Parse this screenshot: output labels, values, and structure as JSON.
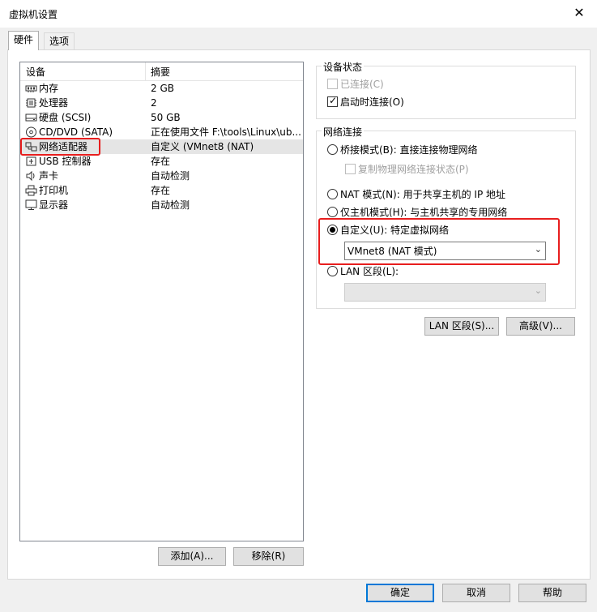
{
  "window": {
    "title": "虚拟机设置",
    "close_label": "✕"
  },
  "tabs": [
    {
      "label": "硬件"
    },
    {
      "label": "选项"
    }
  ],
  "device_list": {
    "headers": {
      "device": "设备",
      "summary": "摘要"
    },
    "rows": [
      {
        "device": "内存",
        "summary": "2 GB",
        "icon": "memory-icon"
      },
      {
        "device": "处理器",
        "summary": "2",
        "icon": "processor-icon"
      },
      {
        "device": "硬盘 (SCSI)",
        "summary": "50 GB",
        "icon": "hard-disk-icon"
      },
      {
        "device": "CD/DVD (SATA)",
        "summary": "正在使用文件 F:\\tools\\Linux\\ub...",
        "icon": "cd-dvd-icon"
      },
      {
        "device": "网络适配器",
        "summary": "自定义 (VMnet8 (NAT)",
        "icon": "network-adapter-icon"
      },
      {
        "device": "USB 控制器",
        "summary": "存在",
        "icon": "usb-icon"
      },
      {
        "device": "声卡",
        "summary": "自动检测",
        "icon": "sound-card-icon"
      },
      {
        "device": "打印机",
        "summary": "存在",
        "icon": "printer-icon"
      },
      {
        "device": "显示器",
        "summary": "自动检测",
        "icon": "display-icon"
      }
    ],
    "selected_index": 4
  },
  "device_status": {
    "title": "设备状态",
    "connected": {
      "label": "已连接(C)",
      "checked": false,
      "enabled": false
    },
    "connect_at_power_on": {
      "label": "启动时连接(O)",
      "checked": true,
      "enabled": true
    }
  },
  "network_connection": {
    "title": "网络连接",
    "bridged": {
      "label": "桥接模式(B): 直接连接物理网络",
      "selected": false
    },
    "replicate_state": {
      "label": "复制物理网络连接状态(P)",
      "checked": false,
      "enabled": false
    },
    "nat": {
      "label": "NAT 模式(N): 用于共享主机的 IP 地址",
      "selected": false
    },
    "host_only": {
      "label": "仅主机模式(H): 与主机共享的专用网络",
      "selected": false
    },
    "custom": {
      "label": "自定义(U): 特定虚拟网络",
      "selected": true
    },
    "custom_network_value": "VMnet8 (NAT 模式)",
    "lan_segment": {
      "label": "LAN 区段(L):",
      "selected": false
    },
    "lan_segment_value": ""
  },
  "buttons": {
    "lan_segments": "LAN 区段(S)...",
    "advanced": "高级(V)...",
    "add": "添加(A)...",
    "remove": "移除(R)",
    "ok": "确定",
    "cancel": "取消",
    "help": "帮助"
  },
  "colors": {
    "highlight_border": "#e81e1e",
    "default_button_border": "#0078d7"
  }
}
